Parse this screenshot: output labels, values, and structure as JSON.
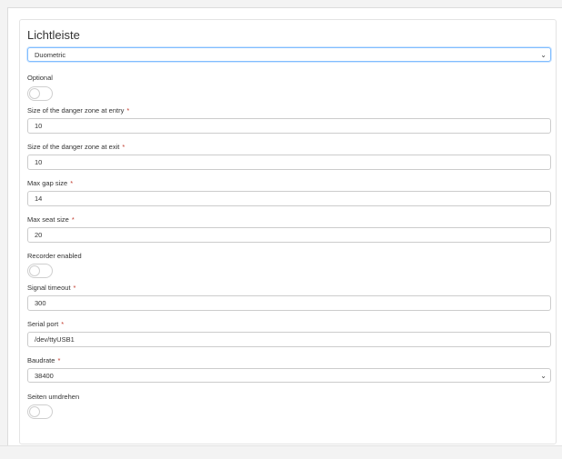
{
  "card": {
    "title": "Lichtleiste"
  },
  "type_select": {
    "value": "Duometric"
  },
  "fields": {
    "optional_label": "Optional",
    "optional_on": false,
    "danger_entry": {
      "label": "Size of the danger zone at entry",
      "value": "10"
    },
    "danger_exit": {
      "label": "Size of the danger zone at exit",
      "value": "10"
    },
    "max_gap": {
      "label": "Max gap size",
      "value": "14"
    },
    "max_seat": {
      "label": "Max seat size",
      "value": "20"
    },
    "recorder_label": "Recorder enabled",
    "recorder_on": false,
    "signal_timeout": {
      "label": "Signal timeout",
      "value": "300"
    },
    "serial_port": {
      "label": "Serial port",
      "value": "/dev/ttyUSB1"
    },
    "baudrate": {
      "label": "Baudrate",
      "value": "38400"
    },
    "flip_label": "Seiten umdrehen",
    "flip_on": false,
    "required_mark": "*"
  },
  "icons": {
    "dropdown": "chevron-down-icon"
  }
}
